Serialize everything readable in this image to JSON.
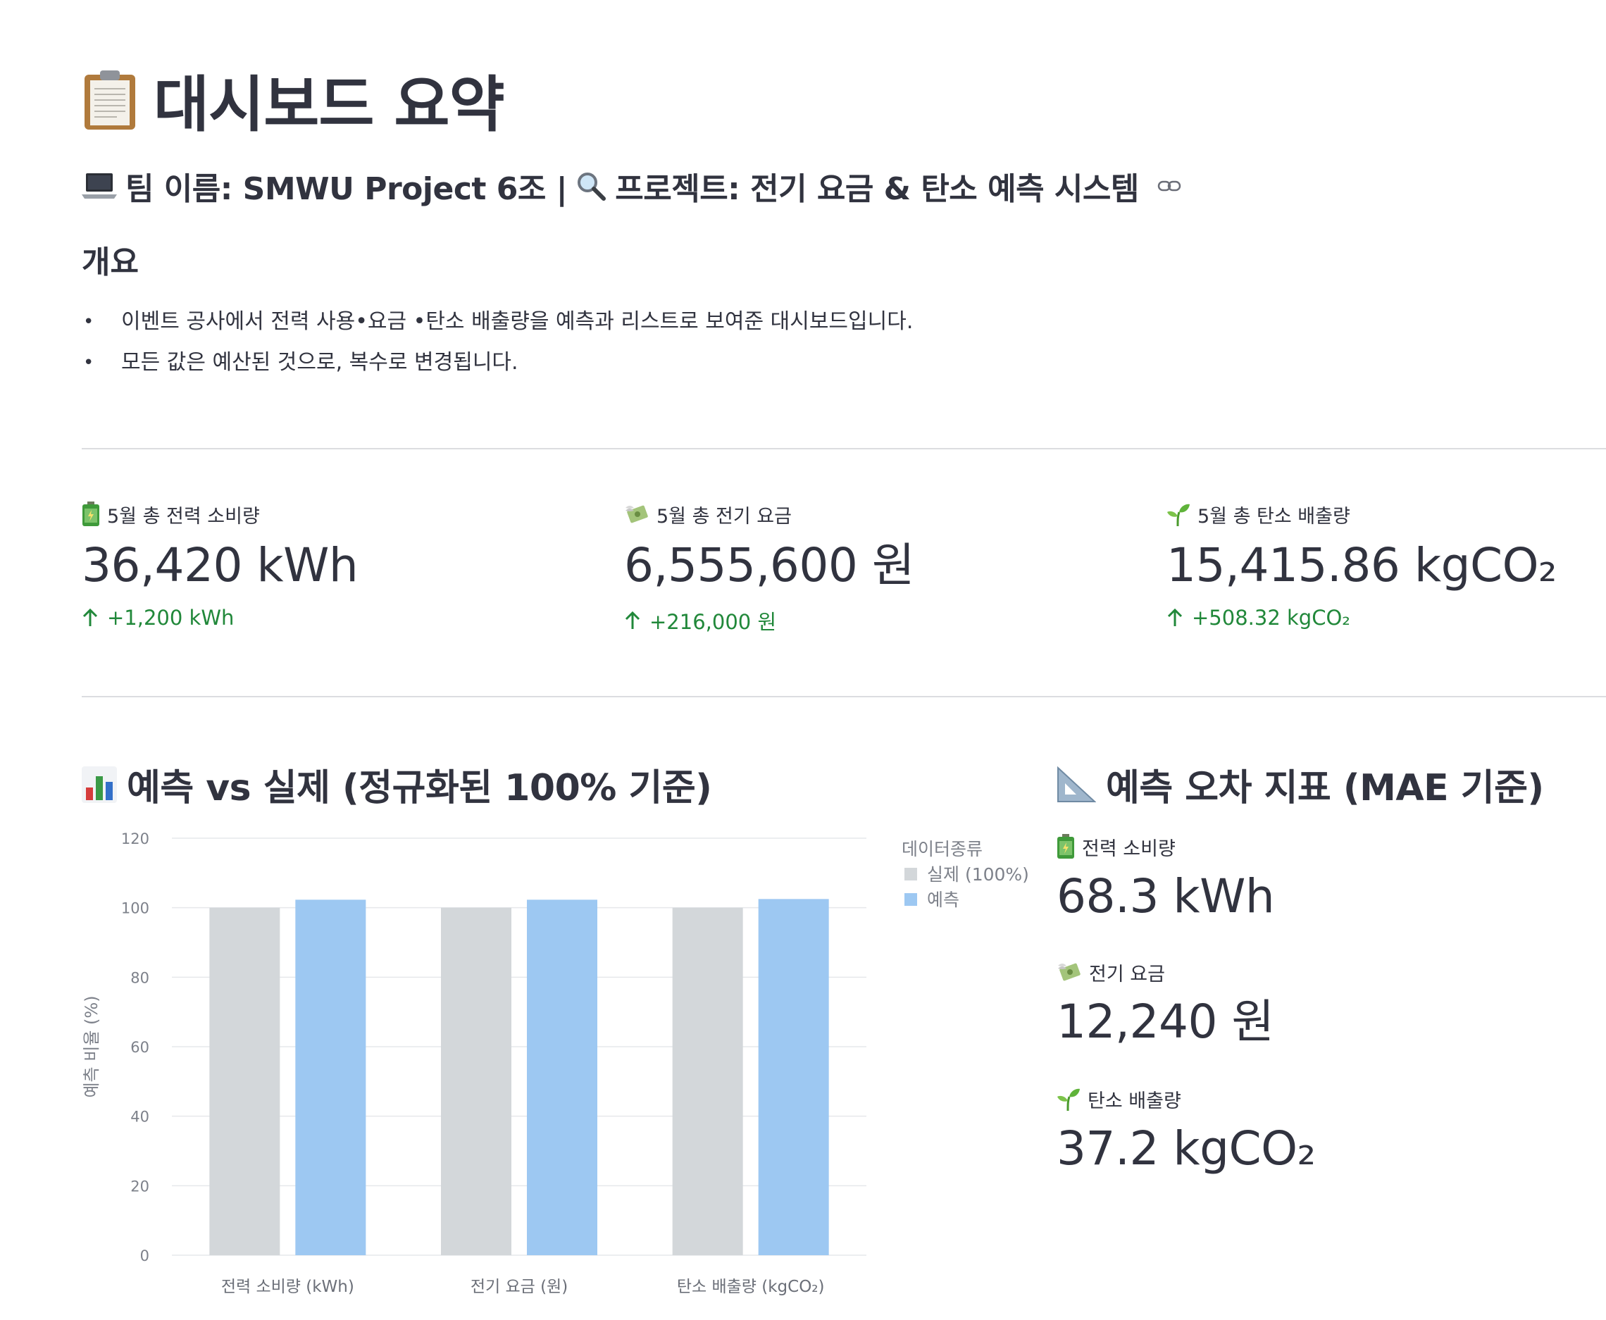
{
  "header": {
    "title_icon": "clipboard-icon",
    "title": "대시보드 요약",
    "team_icon": "laptop-icon",
    "team_text": "팀 이름: SMWU Project 6조 |",
    "project_icon": "magnifier-icon",
    "project_text": "프로젝트: 전기 요금 & 탄소 예측 시스템"
  },
  "overview": {
    "heading": "개요",
    "bullets": [
      "이벤트 공사에서 전력 사용•요금 •탄소 배출량을 예측과 리스트로 보여준 대시보드입니다.",
      "모든 값은 예산된 것으로, 복수로 변경됩니다."
    ]
  },
  "metrics": [
    {
      "icon": "battery-icon",
      "label": "5월 총 전력 소비량",
      "value": "36,420 kWh",
      "delta": "+1,200 kWh"
    },
    {
      "icon": "money-wings-icon",
      "label": "5월 총 전기 요금",
      "value": "6,555,600 원",
      "delta": "+216,000 원"
    },
    {
      "icon": "seedling-icon",
      "label": "5월 총 탄소 배출량",
      "value": "15,415.86 kgCO₂",
      "delta": "+508.32 kgCO₂"
    }
  ],
  "chart_section": {
    "icon": "bar-chart-icon",
    "title": "예측 vs 실제 (정규화된 100% 기준)"
  },
  "mae_section": {
    "icon": "triangle-ruler-icon",
    "title": "예측 오차 지표 (MAE 기준)",
    "items": [
      {
        "icon": "battery-icon",
        "label": "전력 소비량",
        "value": "68.3 kWh"
      },
      {
        "icon": "money-wings-icon",
        "label": "전기 요금",
        "value": "12,240 원"
      },
      {
        "icon": "seedling-icon",
        "label": "탄소 배출량",
        "value": "37.2 kgCO₂"
      }
    ]
  },
  "colors": {
    "actual": "#d3d7da",
    "predicted": "#9dc8f2",
    "delta": "#21883a",
    "text": "#31333f"
  },
  "chart_data": {
    "type": "bar",
    "categories": [
      "전력 소비량 (kWh)",
      "전기 요금 (원)",
      "탄소 배출량 (kgCO₂)"
    ],
    "series": [
      {
        "name": "실제 (100%)",
        "values": [
          100,
          100,
          100
        ]
      },
      {
        "name": "예측",
        "values": [
          102.3,
          102.3,
          102.5
        ]
      }
    ],
    "ylabel": "예측 비율 (%)",
    "ylim": [
      0,
      120
    ],
    "yticks": [
      0,
      20,
      40,
      60,
      80,
      100,
      120
    ],
    "legend_title": "데이터종류",
    "legend_position": "right",
    "grid": true
  }
}
